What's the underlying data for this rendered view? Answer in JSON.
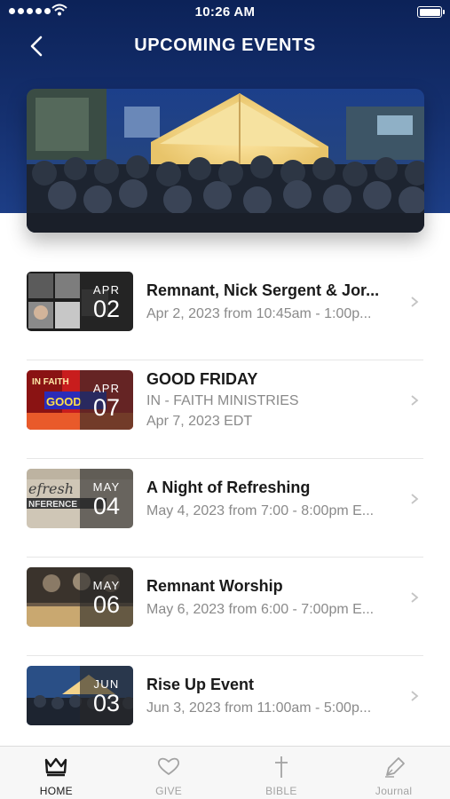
{
  "status": {
    "time": "10:26 AM"
  },
  "header": {
    "title": "UPCOMING EVENTS"
  },
  "events": [
    {
      "month": "APR",
      "day": "02",
      "title": "Remnant, Nick Sergent & Jor...",
      "lines": [
        "Apr 2, 2023 from 10:45am - 1:00p..."
      ],
      "thumb": "concert-poster"
    },
    {
      "month": "APR",
      "day": "07",
      "title": "GOOD FRIDAY",
      "lines": [
        "IN - FAITH MINISTRIES",
        "Apr 7, 2023 EDT"
      ],
      "thumb": "good-friday-poster"
    },
    {
      "month": "MAY",
      "day": "04",
      "title": "A Night of Refreshing",
      "lines": [
        "May 4, 2023 from 7:00 - 8:00pm E..."
      ],
      "thumb": "refresh-conference-poster"
    },
    {
      "month": "MAY",
      "day": "06",
      "title": "Remnant Worship",
      "lines": [
        "May 6, 2023 from 6:00 - 7:00pm E..."
      ],
      "thumb": "worship-poster"
    },
    {
      "month": "JUN",
      "day": "03",
      "title": "Rise Up Event",
      "lines": [
        "Jun 3, 2023 from 11:00am - 5:00p..."
      ],
      "thumb": "tent-crowd-photo"
    }
  ],
  "tabs": [
    {
      "label": "HOME",
      "icon": "crown-icon",
      "active": true
    },
    {
      "label": "GIVE",
      "icon": "heart-icon",
      "active": false
    },
    {
      "label": "BIBLE",
      "icon": "cross-icon",
      "active": false
    },
    {
      "label": "Journal",
      "icon": "pen-icon",
      "active": false
    }
  ],
  "colors": {
    "header_top": "#0c2258",
    "header_bottom": "#1d3e86",
    "text_primary": "#1a1a1a",
    "text_secondary": "#8a8a8a"
  }
}
